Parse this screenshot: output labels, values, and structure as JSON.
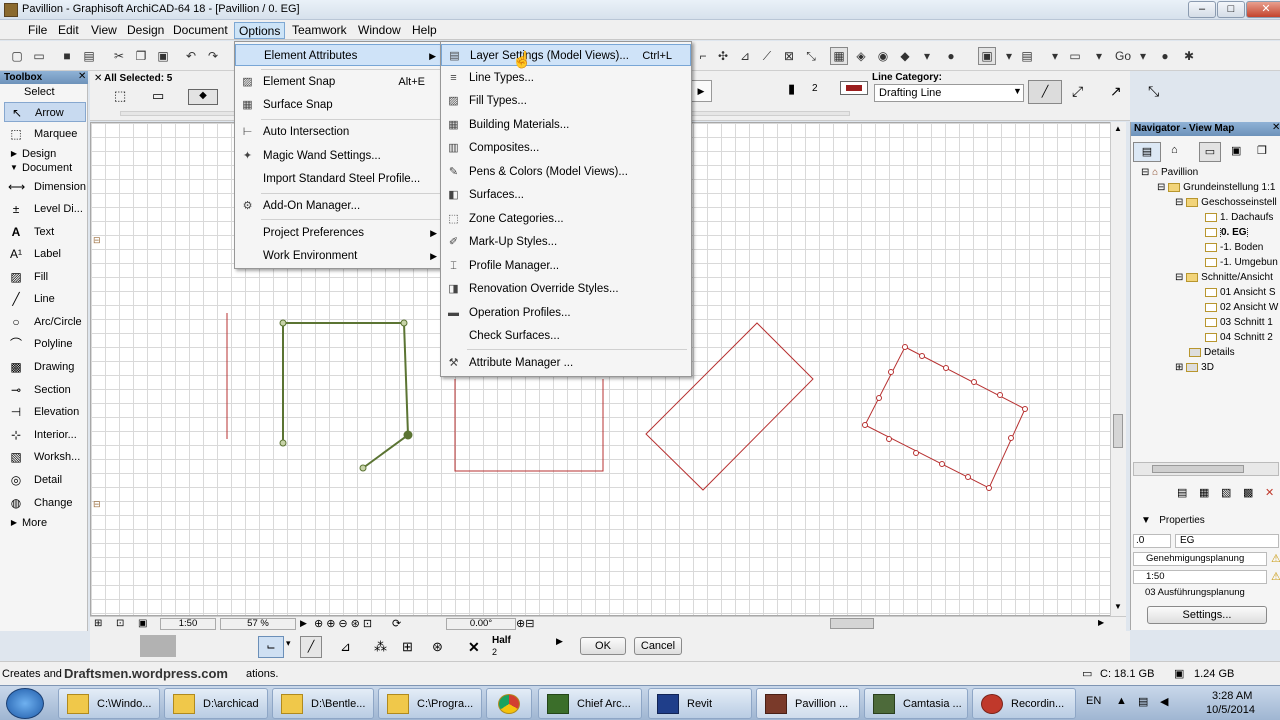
{
  "window": {
    "title": "Pavillion - Graphisoft ArchiCAD-64 18 - [Pavillion / 0. EG]",
    "minimize": "–",
    "maximize": "□",
    "close": "✕"
  },
  "menubar": [
    "File",
    "Edit",
    "View",
    "Design",
    "Document",
    "Options",
    "Teamwork",
    "Window",
    "Help"
  ],
  "toolbox": {
    "title": "Toolbox",
    "select": "Select",
    "groups": {
      "design": "Design",
      "document": "Document"
    },
    "tools": [
      "Arrow",
      "Marquee",
      "Dimension",
      "Level Di...",
      "Text",
      "Label",
      "Fill",
      "Line",
      "Arc/Circle",
      "Polyline",
      "Drawing",
      "Section",
      "Elevation",
      "Interior...",
      "Worksh...",
      "Detail",
      "Change"
    ],
    "more": "More"
  },
  "infobox": {
    "all_selected": "All Selected: 5",
    "pen_number": "2",
    "line_category_label": "Line Category:",
    "line_category_value": "Drafting Line"
  },
  "options_menu": [
    {
      "label": "Element Attributes",
      "shortcut": "",
      "submenu": true
    },
    {
      "label": "Element Snap",
      "shortcut": "Alt+E",
      "submenu": false
    },
    {
      "label": "Surface Snap",
      "shortcut": "",
      "submenu": false
    },
    {
      "label": "Auto Intersection",
      "shortcut": "",
      "submenu": false
    },
    {
      "label": "Magic Wand Settings...",
      "shortcut": "",
      "submenu": false
    },
    {
      "label": "Import Standard Steel Profile...",
      "shortcut": "",
      "submenu": false
    },
    {
      "label": "Add-On Manager...",
      "shortcut": "",
      "submenu": false
    },
    {
      "label": "Project Preferences",
      "shortcut": "",
      "submenu": true
    },
    {
      "label": "Work Environment",
      "shortcut": "",
      "submenu": true
    }
  ],
  "attributes_submenu": [
    {
      "label": "Layer Settings (Model Views)...",
      "shortcut": "Ctrl+L"
    },
    {
      "label": "Line Types...",
      "shortcut": ""
    },
    {
      "label": "Fill Types...",
      "shortcut": ""
    },
    {
      "label": "Building Materials...",
      "shortcut": ""
    },
    {
      "label": "Composites...",
      "shortcut": ""
    },
    {
      "label": "Pens & Colors (Model Views)...",
      "shortcut": ""
    },
    {
      "label": "Surfaces...",
      "shortcut": ""
    },
    {
      "label": "Zone Categories...",
      "shortcut": ""
    },
    {
      "label": "Mark-Up Styles...",
      "shortcut": ""
    },
    {
      "label": "Profile Manager...",
      "shortcut": ""
    },
    {
      "label": "Renovation Override Styles...",
      "shortcut": ""
    },
    {
      "label": "Operation Profiles...",
      "shortcut": ""
    },
    {
      "label": "Check Surfaces...",
      "shortcut": ""
    },
    {
      "label": "Attribute Manager ...",
      "shortcut": ""
    }
  ],
  "navigator": {
    "title": "Navigator - View Map",
    "tree": [
      "Pavillion",
      "Grundeinstellung 1:1",
      "Geschosseinstell",
      "1. Dachaufs",
      "0. EG",
      "-1. Boden",
      "-1. Umgebun",
      "Schnitte/Ansicht",
      "01 Ansicht S",
      "02 Ansicht W",
      "03 Schnitt 1",
      "04 Schnitt 2",
      "Details",
      "3D"
    ],
    "properties": "Properties",
    "prop_id": ".0",
    "prop_name": "EG",
    "layer_combo": "Genehmigungsplanung",
    "scale": "1:50",
    "pen_set": "03 Ausführungsplanung",
    "settings": "Settings..."
  },
  "bottom": {
    "scale": "1:50",
    "zoom": "57 %",
    "angle": "0.00°"
  },
  "lower": {
    "half": "Half",
    "half_num": "2",
    "ok": "OK",
    "cancel": "Cancel"
  },
  "status": {
    "text": "Creates and",
    "overlay": "Draftsmen.wordpress.com",
    "suffix": "ations.",
    "disk": "C: 18.1 GB",
    "ram": "1.24 GB"
  },
  "taskbar": {
    "items": [
      "C:\\Windo...",
      "D:\\archicad",
      "D:\\Bentle...",
      "C:\\Progra...",
      "",
      "Chief Arc...",
      "Revit",
      "Pavillion ...",
      "Camtasia ...",
      "Recordin..."
    ],
    "lang": "EN",
    "time": "3:28 AM",
    "date": "10/5/2014"
  }
}
